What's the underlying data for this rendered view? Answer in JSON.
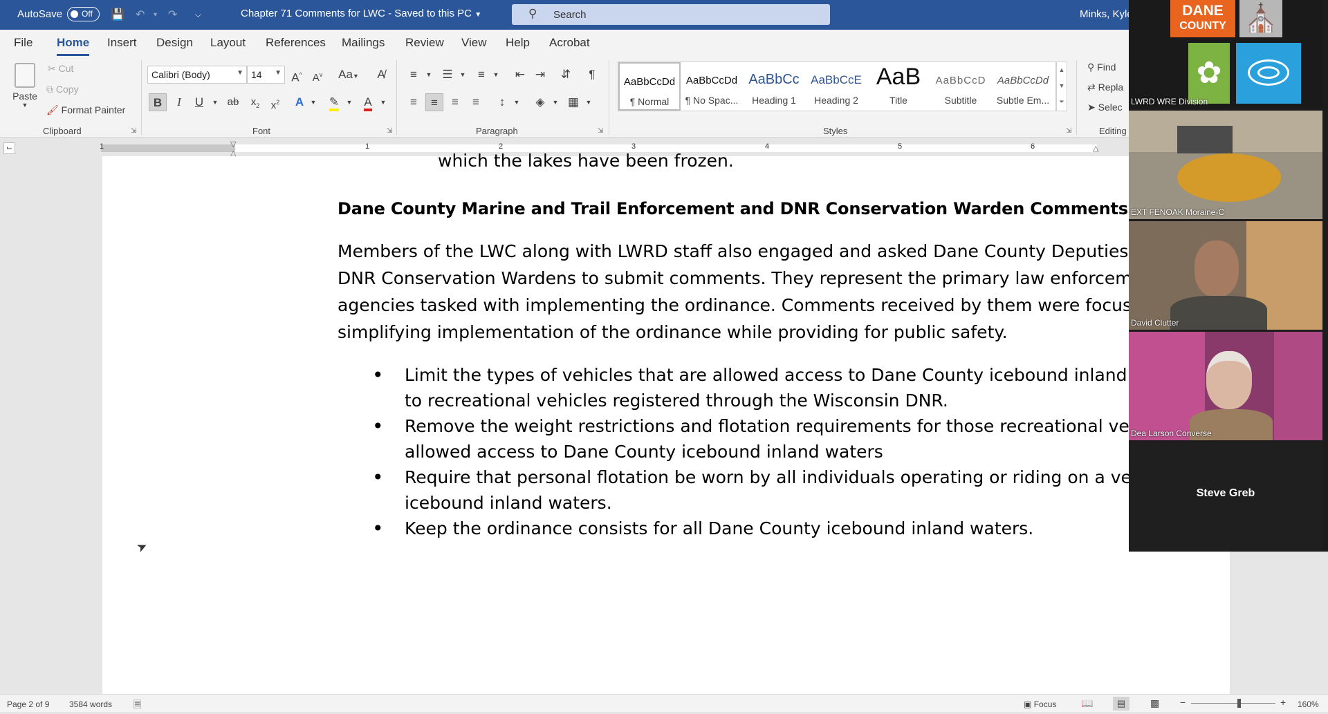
{
  "titlebar": {
    "autosave_label": "AutoSave",
    "autosave_state": "Off",
    "doc_title": "Chapter 71 Comments for LWC  -  Saved to this PC",
    "search_placeholder": "Search",
    "user": "Minks, Kyle"
  },
  "tabs": [
    "File",
    "Home",
    "Insert",
    "Design",
    "Layout",
    "References",
    "Mailings",
    "Review",
    "View",
    "Help",
    "Acrobat"
  ],
  "ribbon": {
    "clipboard": {
      "paste": "Paste",
      "cut": "Cut",
      "copy": "Copy",
      "format_painter": "Format Painter",
      "label": "Clipboard"
    },
    "font": {
      "family": "Calibri (Body)",
      "size": "14",
      "label": "Font"
    },
    "paragraph": {
      "label": "Paragraph"
    },
    "styles": {
      "label": "Styles",
      "items": [
        {
          "sample": "AaBbCcDd",
          "name": "¶ Normal"
        },
        {
          "sample": "AaBbCcDd",
          "name": "¶ No Spac..."
        },
        {
          "sample": "AaBbCc",
          "name": "Heading 1"
        },
        {
          "sample": "AaBbCcE",
          "name": "Heading 2"
        },
        {
          "sample": "AaB",
          "name": "Title"
        },
        {
          "sample": "AaBbCcD",
          "name": "Subtitle"
        },
        {
          "sample": "AaBbCcDd",
          "name": "Subtle Em..."
        }
      ]
    },
    "editing": {
      "find": "Find",
      "replace": "Repla",
      "select": "Selec",
      "label": "Editing"
    }
  },
  "ruler": {
    "numbers": [
      "1",
      "1",
      "2",
      "3",
      "4",
      "5",
      "6"
    ]
  },
  "document": {
    "fragment": "which the lakes have been frozen.",
    "heading": "Dane County Marine and Trail Enforcement and DNR Conservation Warden Comments:",
    "paragraph": "Members of the LWC along with LWRD staff also engaged and asked Dane County Deputies and DNR Conservation Wardens to submit comments. They represent the primary law enforcement agencies tasked with implementing the ordinance. Comments received by them were focused on simplifying implementation of the ordinance while providing for public safety.",
    "bullets": [
      "Limit the types of vehicles that are allowed access to Dane County icebound inland waters to recreational vehicles registered through the Wisconsin DNR.",
      "Remove the weight restrictions and flotation requirements for those recreational vehicles allowed access to Dane County icebound inland waters",
      "Require that personal flotation be worn by all individuals operating or riding on a vehicle on icebound inland waters.",
      "Keep the ordinance consists for all Dane County icebound inland waters."
    ]
  },
  "status": {
    "page": "Page 2 of 9",
    "words": "3584 words",
    "focus": "Focus",
    "zoom": "160%"
  },
  "video": {
    "logo_line1": "DANE",
    "logo_line2": "COUNTY",
    "participants": [
      "LWRD WRE Division",
      "EXT FENOAK Moraine-C",
      "David Clutter",
      "Dea Larson Converse",
      "Steve Greb"
    ]
  }
}
